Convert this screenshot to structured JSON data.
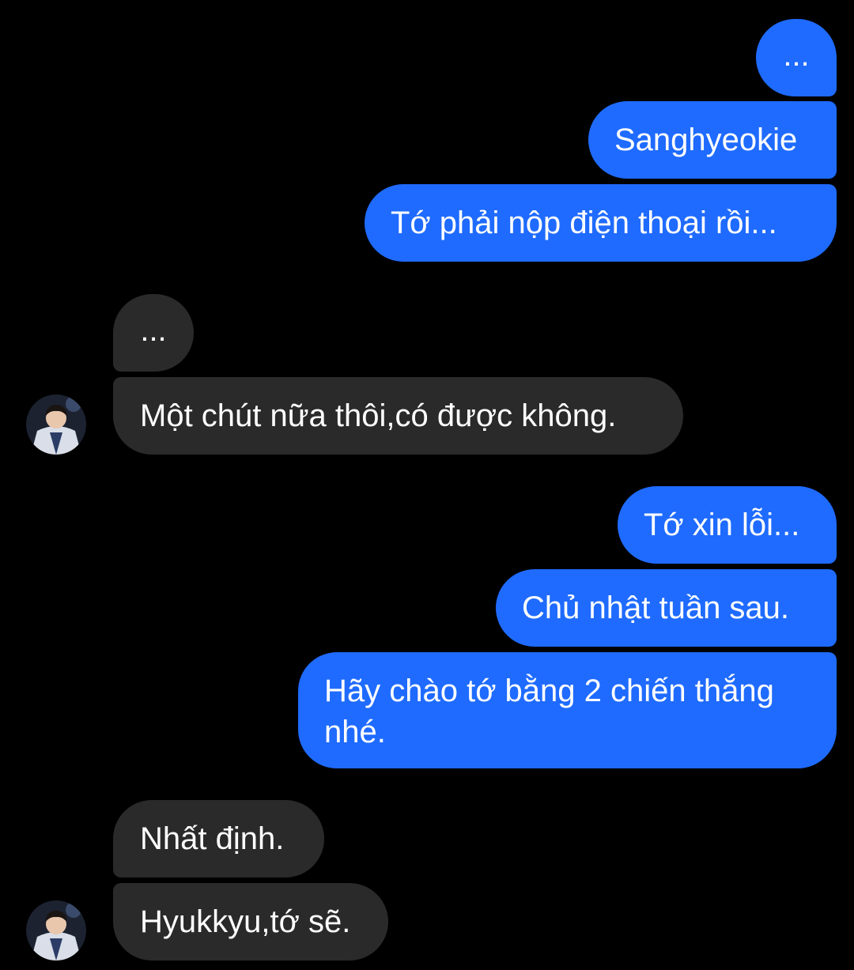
{
  "colors": {
    "background": "#000000",
    "outgoing_bubble": "#1f6bff",
    "incoming_bubble": "#2a2a2a",
    "text": "#ffffff"
  },
  "messages": [
    {
      "side": "outgoing",
      "text": "..."
    },
    {
      "side": "outgoing",
      "text": "Sanghyeokie"
    },
    {
      "side": "outgoing",
      "text": "Tớ phải nộp điện thoại rồi..."
    },
    {
      "side": "incoming",
      "text": "..."
    },
    {
      "side": "incoming",
      "text": "Một chút nữa thôi,có được không."
    },
    {
      "side": "outgoing",
      "text": "Tớ xin lỗi..."
    },
    {
      "side": "outgoing",
      "text": "Chủ nhật tuần sau."
    },
    {
      "side": "outgoing",
      "text": "Hãy chào tớ bằng 2 chiến thắng nhé."
    },
    {
      "side": "incoming",
      "text": "Nhất định."
    },
    {
      "side": "incoming",
      "text": "Hyukkyu,tớ sẽ."
    }
  ]
}
